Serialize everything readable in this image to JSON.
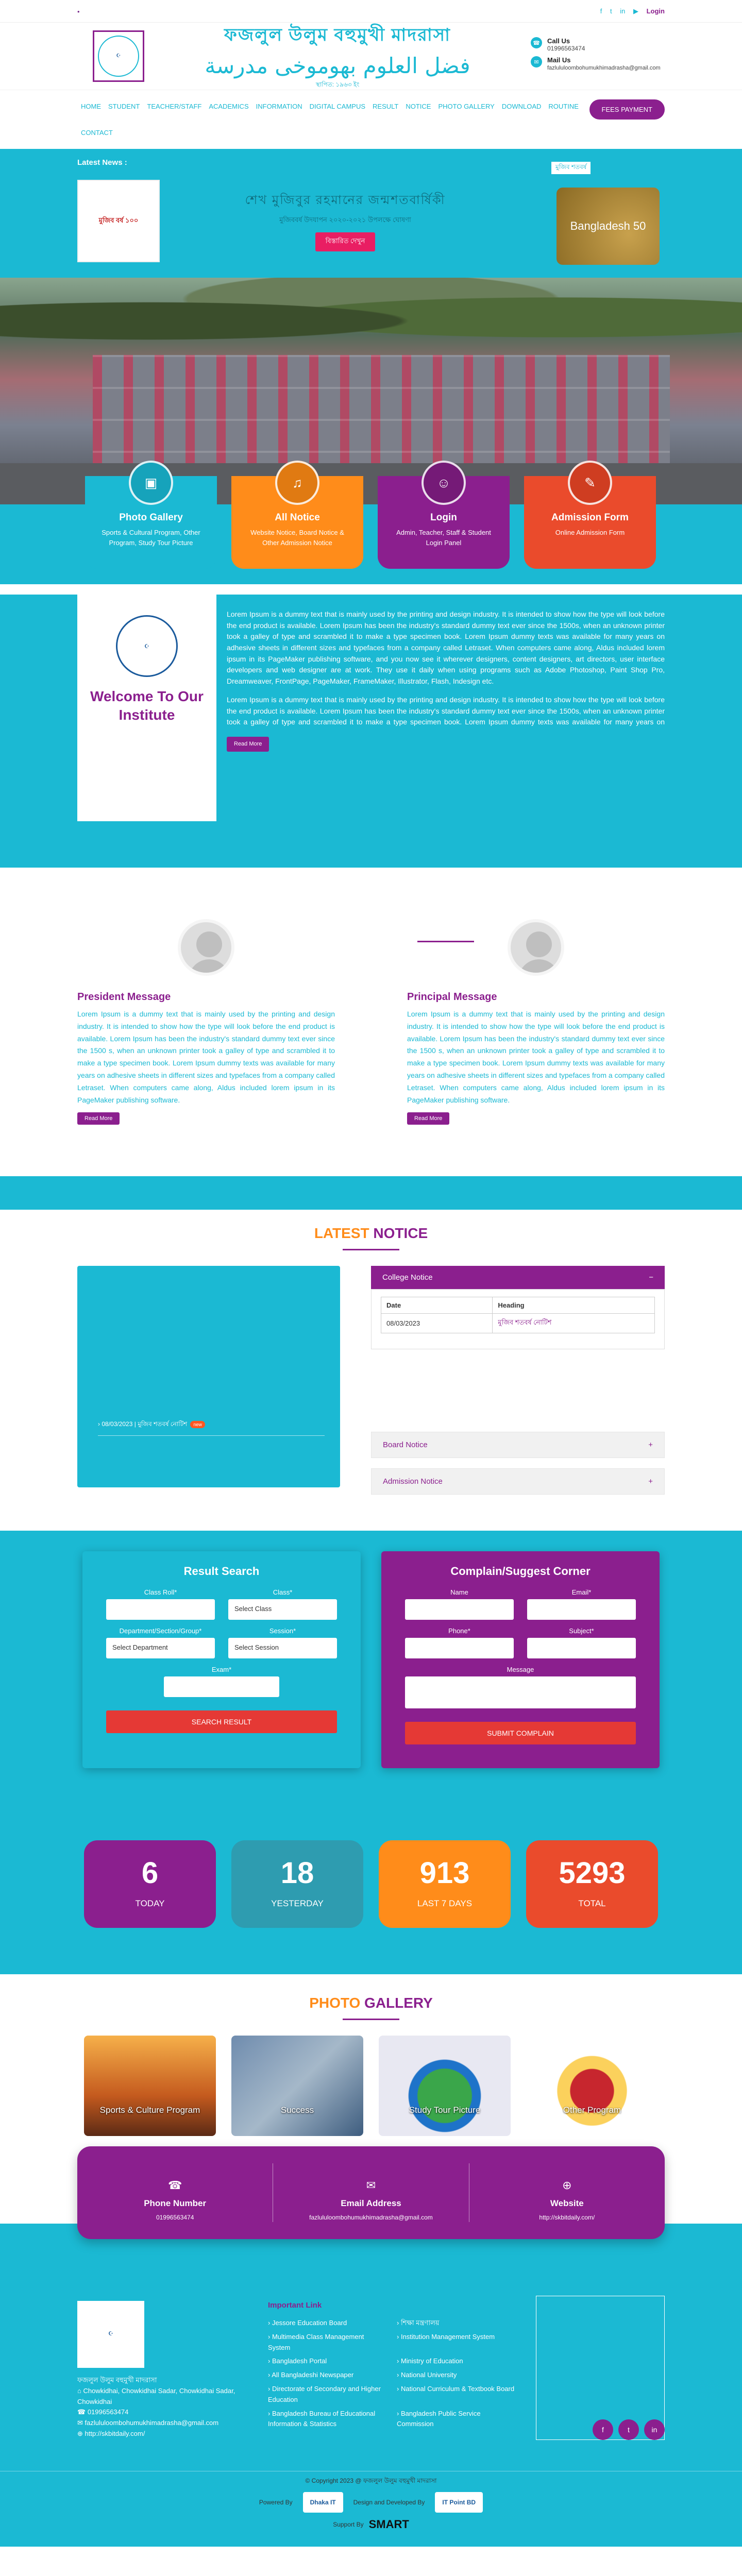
{
  "topbar": {
    "left": "",
    "social": [
      "f",
      "t",
      "in",
      "▶"
    ],
    "login": "Login"
  },
  "header": {
    "school_bn": "ফজলুল উলুম বহুমুখী মাদরাসা",
    "school_ar": "فضل العلوم بهوموخى مدرسة",
    "subtitle": "স্থাপিত: ১৯৬৩ ইং",
    "call_label": "Call Us",
    "call_value": "01996563474",
    "mail_label": "Mail Us",
    "mail_value": "fazlululoombohumukhimadrasha@gmail.com"
  },
  "nav": {
    "items": [
      "Home",
      "Student",
      "Teacher/Staff",
      "Academics",
      "Information",
      "Digital Campus",
      "Result",
      "Notice",
      "Photo Gallery",
      "Download",
      "Routine",
      "Contact"
    ],
    "fees_button": "FEES PAYMENT"
  },
  "news": {
    "label": "Latest News :",
    "title": "শেখ মুজিবুর রহমানের জন্মশতবার্ষিকী",
    "subtitle": "মুজিববর্ষ উদযাপন ২০২০-২০২১ উপলক্ষে ঘোষণা",
    "button": "বিস্তারিত দেখুন",
    "top_right": "মুজিব শতবর্ষ",
    "image_caption": "মুজিব বর্ষ ১০০",
    "bd_logo": "Bangladesh 50"
  },
  "features": [
    {
      "title": "Photo Gallery",
      "desc": "Sports & Cultural Program, Other Program, Study Tour Picture",
      "icon": "image-icon"
    },
    {
      "title": "All Notice",
      "desc": "Website Notice, Board Notice & Other Admission Notice",
      "icon": "bell-icon"
    },
    {
      "title": "Login",
      "desc": "Admin, Teacher, Staff & Student Login Panel",
      "icon": "user-icon"
    },
    {
      "title": "Admission Form",
      "desc": "Online Admission Form",
      "icon": "form-icon"
    }
  ],
  "welcome": {
    "heading": "Welcome To Our Institute",
    "para1": "Lorem Ipsum is a dummy text that is mainly used by the printing and design industry. It is intended to show how the type will look before the end product is available. Lorem Ipsum has been the industry's standard dummy text ever since the 1500s, when an unknown printer took a galley of type and scrambled it to make a type specimen book. Lorem Ipsum dummy texts was available for many years on adhesive sheets in different sizes and typefaces from a company called Letraset. When computers came along, Aldus included lorem ipsum in its PageMaker publishing software, and you now see it wherever designers, content designers, art directors, user interface developers and web designer are at work. They use it daily when using programs such as Adobe Photoshop, Paint Shop Pro, Dreamweaver, FrontPage, PageMaker, FrameMaker, Illustrator, Flash, Indesign etc.",
    "para2": "Lorem Ipsum is a dummy text that is mainly used by the printing and design industry. It is intended to show how the type will look before the end product is available. Lorem Ipsum has been the industry's standard dummy text ever since the 1500s, when an unknown printer took a galley of type and scrambled it to make a type specimen book. Lorem Ipsum dummy texts was available for many years on adhesive sheets in different sizes and typefaces from a company called Letraset. When computers came along,",
    "button": "Read More"
  },
  "messages": [
    {
      "title": "President Message",
      "text": "Lorem Ipsum is a dummy text that is mainly used by the printing and design industry. It is intended to show how the type will look before the end product is available. Lorem Ipsum has been the industry's standard dummy text ever since the 1500 s, when an unknown printer took a galley of type and scrambled it to make a type specimen book. Lorem Ipsum dummy texts was available for many years on adhesive sheets in different sizes and typefaces from a company called Letraset. When computers came along, Aldus included lorem ipsum in its PageMaker publishing software.",
      "button": "Read More"
    },
    {
      "title": "Principal Message",
      "text": "Lorem Ipsum is a dummy text that is mainly used by the printing and design industry. It is intended to show how the type will look before the end product is available. Lorem Ipsum has been the industry's standard dummy text ever since the 1500 s, when an unknown printer took a galley of type and scrambled it to make a type specimen book. Lorem Ipsum dummy texts was available for many years on adhesive sheets in different sizes and typefaces from a company called Letraset. When computers came along, Aldus included lorem ipsum in its PageMaker publishing software.",
      "button": "Read More"
    }
  ],
  "notice": {
    "title_a": "LATEST",
    "title_b": "NOTICE",
    "box_item_date": "08/03/2023",
    "box_item_text": "মুজিব শতবর্ষ নোটিশ",
    "box_item_badge": "new",
    "college": {
      "label": "College Notice",
      "col_date": "Date",
      "col_heading": "Heading",
      "row_date": "08/03/2023",
      "row_heading": "মুজিব শতবর্ষ নোটিশ"
    },
    "board_label": "Board Notice",
    "admission_label": "Admission Notice"
  },
  "result": {
    "title": "Result Search",
    "class_roll_label": "Class Roll*",
    "class_label": "Class*",
    "class_value": "Select Class",
    "dept_label": "Department/Section/Group*",
    "dept_value": "Select Department",
    "session_label": "Session*",
    "session_value": "Select Session",
    "exam_label": "Exam*",
    "button": "SEARCH RESULT"
  },
  "complain": {
    "title": "Complain/Suggest Corner",
    "name_label": "Name",
    "email_label": "Email*",
    "phone_label": "Phone*",
    "subject_label": "Subject*",
    "message_label": "Message",
    "button": "SUBMIT COMPLAIN"
  },
  "stats": [
    {
      "value": "6",
      "label": "TODAY"
    },
    {
      "value": "18",
      "label": "YESTERDAY"
    },
    {
      "value": "913",
      "label": "LAST 7 DAYS"
    },
    {
      "value": "5293",
      "label": "TOTAL"
    }
  ],
  "gallery": {
    "title_a": "PHOTO",
    "title_b": "GALLERY",
    "items": [
      "Sports & Culture Program",
      "Success",
      "Study Tour Picture",
      "Other Program"
    ]
  },
  "contact_bar": [
    {
      "label": "Phone Number",
      "value": "01996563474"
    },
    {
      "label": "Email Address",
      "value": "fazlululoombohumukhimadrasha@gmail.com"
    },
    {
      "label": "Website",
      "value": "http://skbitdaily.com/"
    }
  ],
  "footer": {
    "address_title": "ফজলুল উলুম বহুমুখী মাদরাসা",
    "address": "Chowkidhai, Chowkidhai Sadar, Chowkidhai Sadar, Chowkidhai",
    "phone": "01996563474",
    "email": "fazlululoombohumukhimadrasha@gmail.com",
    "web": "http://skbitdaily.com/",
    "links_title": "Important Link",
    "links": [
      "Jessore Education Board",
      "শিক্ষা মন্ত্রণালয়",
      "Multimedia Class Management System",
      "Institution Management System",
      "Bangladesh Portal",
      "Ministry of Education",
      "All Bangladeshi Newspaper",
      "National University",
      "Directorate of Secondary and Higher Education",
      "National Curriculum & Textbook Board",
      "Bangladesh Bureau of Educational Information & Statistics",
      "Bangladesh Public Service Commission"
    ],
    "copyright": "© Copyright 2023 @ ফজলুল উলুম বহুমুখী মাদরাসা",
    "powered": "Powered By",
    "powered_logo1": "Dhaka IT",
    "design": "Design and Developed By",
    "powered_logo2": "IT Point BD",
    "support": "Support By",
    "smart": "SMART"
  }
}
